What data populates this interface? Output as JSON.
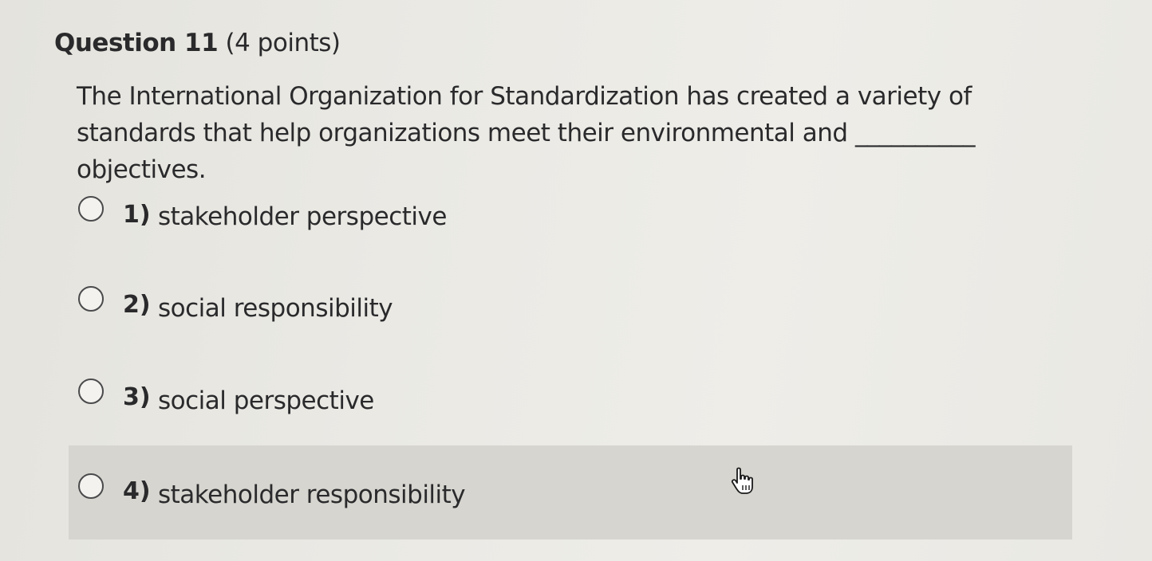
{
  "question": {
    "number": "Question 11",
    "points": "(4 points)",
    "text": "The International Organization for Standardization has created a variety of standards that help organizations meet their environmental and __________ objectives."
  },
  "options": [
    {
      "num": "1)",
      "label": "stakeholder perspective"
    },
    {
      "num": "2)",
      "label": "social responsibility"
    },
    {
      "num": "3)",
      "label": "social perspective"
    },
    {
      "num": "4)",
      "label": "stakeholder responsibility"
    }
  ],
  "state": {
    "hovered_option": "4)",
    "cursor_icon": "hand-pointer-icon"
  }
}
